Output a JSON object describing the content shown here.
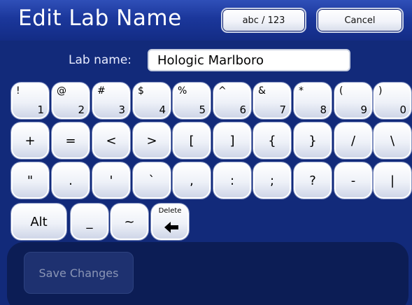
{
  "header": {
    "title": "Edit Lab Name",
    "mode_button": "abc / 123",
    "cancel_button": "Cancel"
  },
  "form": {
    "label": "Lab name:",
    "value": "Hologic Marlboro"
  },
  "keyboard": {
    "row1": [
      {
        "top": "!",
        "bottom": "1"
      },
      {
        "top": "@",
        "bottom": "2"
      },
      {
        "top": "#",
        "bottom": "3"
      },
      {
        "top": "$",
        "bottom": "4"
      },
      {
        "top": "%",
        "bottom": "5"
      },
      {
        "top": "^",
        "bottom": "6"
      },
      {
        "top": "&",
        "bottom": "7"
      },
      {
        "top": "*",
        "bottom": "8"
      },
      {
        "top": "(",
        "bottom": "9"
      },
      {
        "top": ")",
        "bottom": "0"
      }
    ],
    "row2": [
      "+",
      "=",
      "<",
      ">",
      "[",
      "]",
      "{",
      "}",
      "/",
      "\\"
    ],
    "row3": [
      "\"",
      ".",
      "'",
      "`",
      ",",
      ":",
      ";",
      "?",
      "-",
      "|"
    ],
    "row4": {
      "alt": "Alt",
      "underscore": "_",
      "tilde": "~",
      "delete": "Delete"
    }
  },
  "footer": {
    "save_button": "Save Changes"
  }
}
